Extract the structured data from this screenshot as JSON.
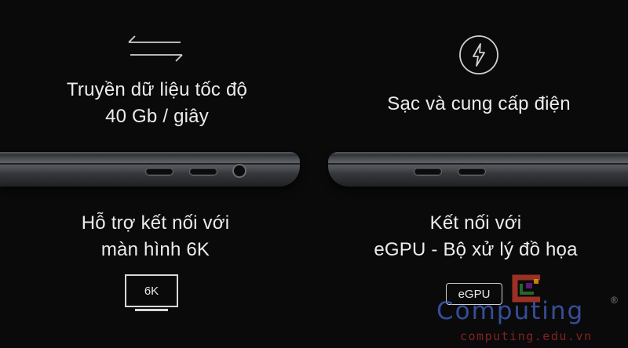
{
  "features": {
    "data": {
      "icon": "transfer-arrows-icon",
      "line1": "Truyền dữ liệu tốc độ",
      "line2": "40 Gb / giây"
    },
    "charging": {
      "icon": "lightning-bolt-icon",
      "line1": "Sạc và cung cấp điện"
    },
    "display": {
      "icon": "monitor-icon",
      "line1": "Hỗ trợ kết nối với",
      "line2": "màn hình 6K",
      "badge": "6K"
    },
    "egpu": {
      "icon": "egpu-box-icon",
      "line1": "Kết nối với",
      "line2": "eGPU - Bộ xử lý đồ họa",
      "badge": "eGPU"
    }
  },
  "watermark": {
    "brand": "Computing",
    "registered": "®",
    "url": "computing.edu.vn",
    "logo_colors": [
      "#c0392b",
      "#2e7d32",
      "#7b1fa2",
      "#f39c12"
    ]
  }
}
